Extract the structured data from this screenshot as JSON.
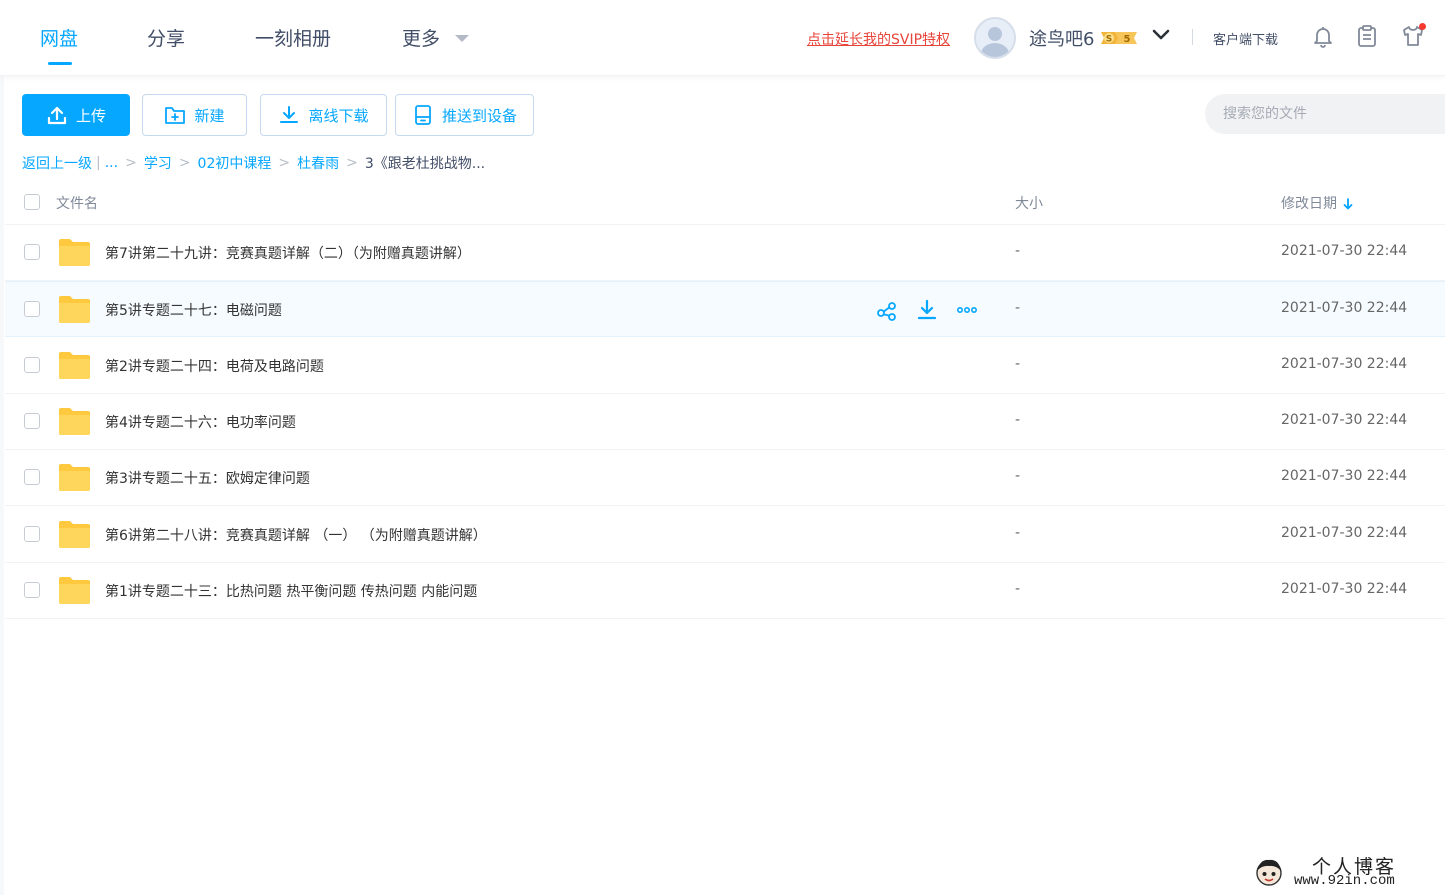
{
  "nav": {
    "items": [
      {
        "label": "网盘",
        "active": true
      },
      {
        "label": "分享",
        "active": false
      },
      {
        "label": "一刻相册",
        "active": false
      },
      {
        "label": "更多",
        "active": false
      }
    ]
  },
  "header": {
    "svip_link": "点击延长我的SVIP特权",
    "username": "途鸟吧6",
    "vip_level": "5",
    "client_download": "客户端下载"
  },
  "toolbar": {
    "upload": "上传",
    "new": "新建",
    "offline_download": "离线下载",
    "push_to_device": "推送到设备",
    "search_placeholder": "搜索您的文件"
  },
  "breadcrumb": {
    "back": "返回上一级",
    "ellipsis": "...",
    "items": [
      "学习",
      "02初中课程",
      "杜春雨"
    ],
    "current": "3《跟老杜挑战物..."
  },
  "table": {
    "headers": {
      "name": "文件名",
      "size": "大小",
      "modified": "修改日期"
    },
    "rows": [
      {
        "name": "第7讲第二十九讲：竞赛真题详解（二）（为附赠真题讲解）",
        "size": "-",
        "modified": "2021-07-30 22:44"
      },
      {
        "name": "第5讲专题二十七：电磁问题",
        "size": "-",
        "modified": "2021-07-30 22:44"
      },
      {
        "name": "第2讲专题二十四：电荷及电路问题",
        "size": "-",
        "modified": "2021-07-30 22:44"
      },
      {
        "name": "第4讲专题二十六：电功率问题",
        "size": "-",
        "modified": "2021-07-30 22:44"
      },
      {
        "name": "第3讲专题二十五：欧姆定律问题",
        "size": "-",
        "modified": "2021-07-30 22:44"
      },
      {
        "name": "第6讲第二十八讲：竞赛真题详解 （一） （为附赠真题讲解）",
        "size": "-",
        "modified": "2021-07-30 22:44"
      },
      {
        "name": "第1讲专题二十三：比热问题 热平衡问题 传热问题 内能问题",
        "size": "-",
        "modified": "2021-07-30 22:44"
      }
    ]
  },
  "watermark": {
    "title": "个人博客",
    "url": "www.92in.com"
  },
  "colors": {
    "accent": "#06a7ff",
    "svip_link": "#e7443a",
    "folder": "#ffd24d"
  },
  "icons": [
    "upload-icon",
    "new-folder-icon",
    "download-icon",
    "device-icon",
    "bell-icon",
    "clipboard-icon",
    "shirt-icon",
    "share-icon",
    "more-icon",
    "folder-icon"
  ]
}
